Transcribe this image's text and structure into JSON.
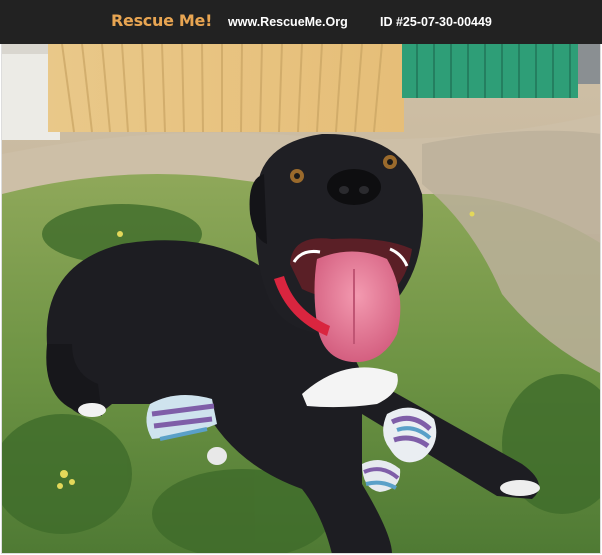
{
  "header": {
    "logo_text": "Rescue Me!",
    "site_url": "www.RescueMe.Org",
    "listing_id": "ID #25-07-30-00449"
  },
  "photo": {
    "subject": "dog-photo"
  },
  "colors": {
    "header_bg": "#222222",
    "logo": "#e8a552",
    "header_text": "#ffffff"
  }
}
